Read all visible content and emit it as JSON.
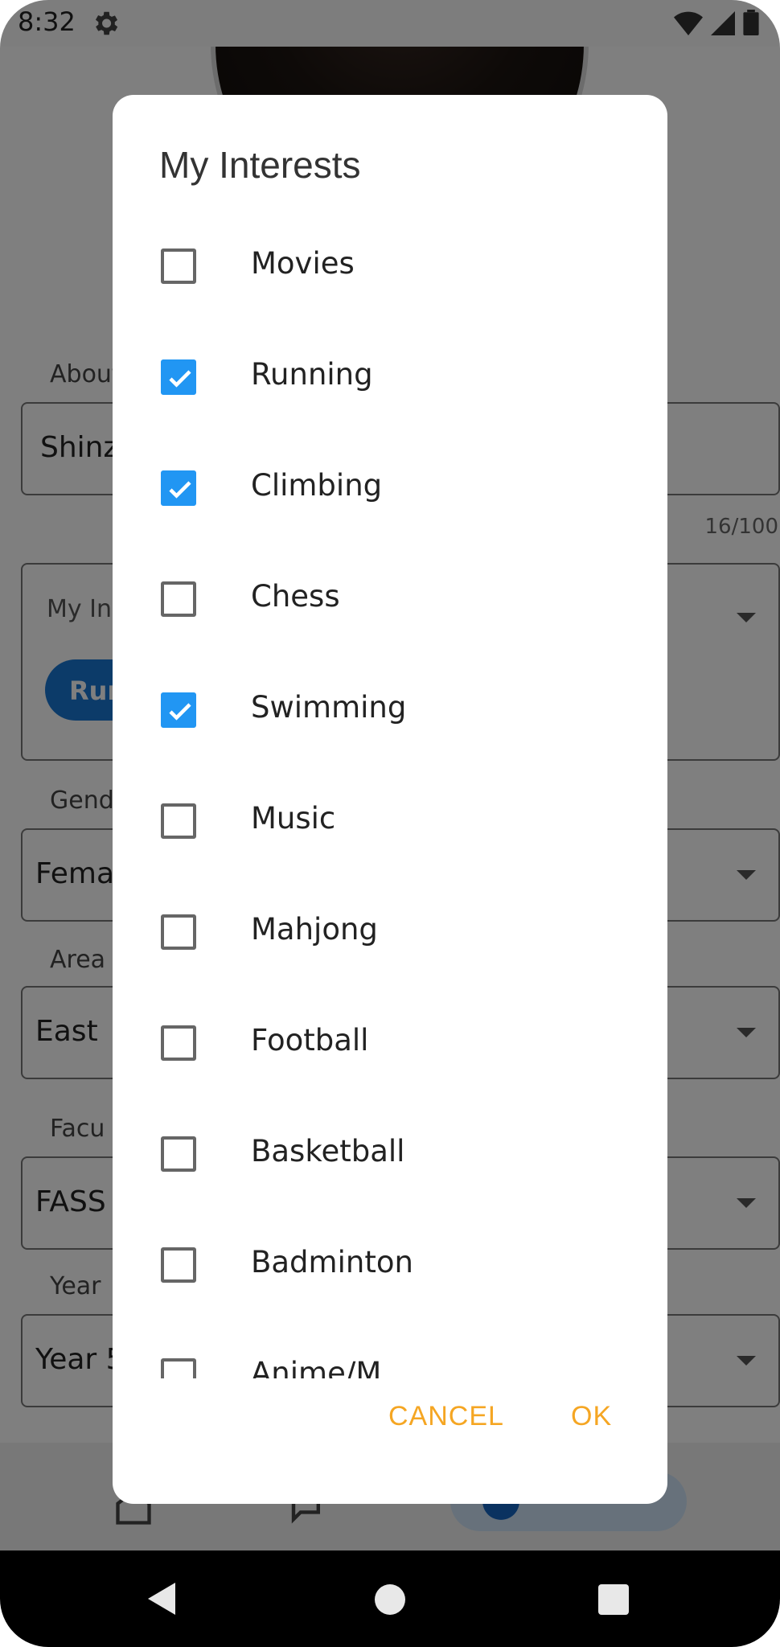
{
  "status_bar": {
    "time": "8:32"
  },
  "background": {
    "about_label": "About",
    "about_value": "Shinz",
    "about_counter": "16/100",
    "interests_label": "My In",
    "interest_chip": "Run",
    "gender_label": "Gend",
    "gender_value": "Fema",
    "area_label": "Area",
    "area_value": "East",
    "faculty_label": "Facu",
    "faculty_value": "FASS",
    "year_label": "Year",
    "year_value": "Year 5"
  },
  "dialog": {
    "title": "My Interests",
    "items": [
      {
        "label": "Movies",
        "checked": false
      },
      {
        "label": "Running",
        "checked": true
      },
      {
        "label": "Climbing",
        "checked": true
      },
      {
        "label": "Chess",
        "checked": false
      },
      {
        "label": "Swimming",
        "checked": true
      },
      {
        "label": "Music",
        "checked": false
      },
      {
        "label": "Mahjong",
        "checked": false
      },
      {
        "label": "Football",
        "checked": false
      },
      {
        "label": "Basketball",
        "checked": false
      },
      {
        "label": "Badminton",
        "checked": false
      },
      {
        "label": "Anime/M",
        "checked": false
      }
    ],
    "cancel_label": "CANCEL",
    "ok_label": "OK"
  },
  "colors": {
    "checkbox_checked": "#2196f3",
    "action_text": "#f5a623"
  }
}
